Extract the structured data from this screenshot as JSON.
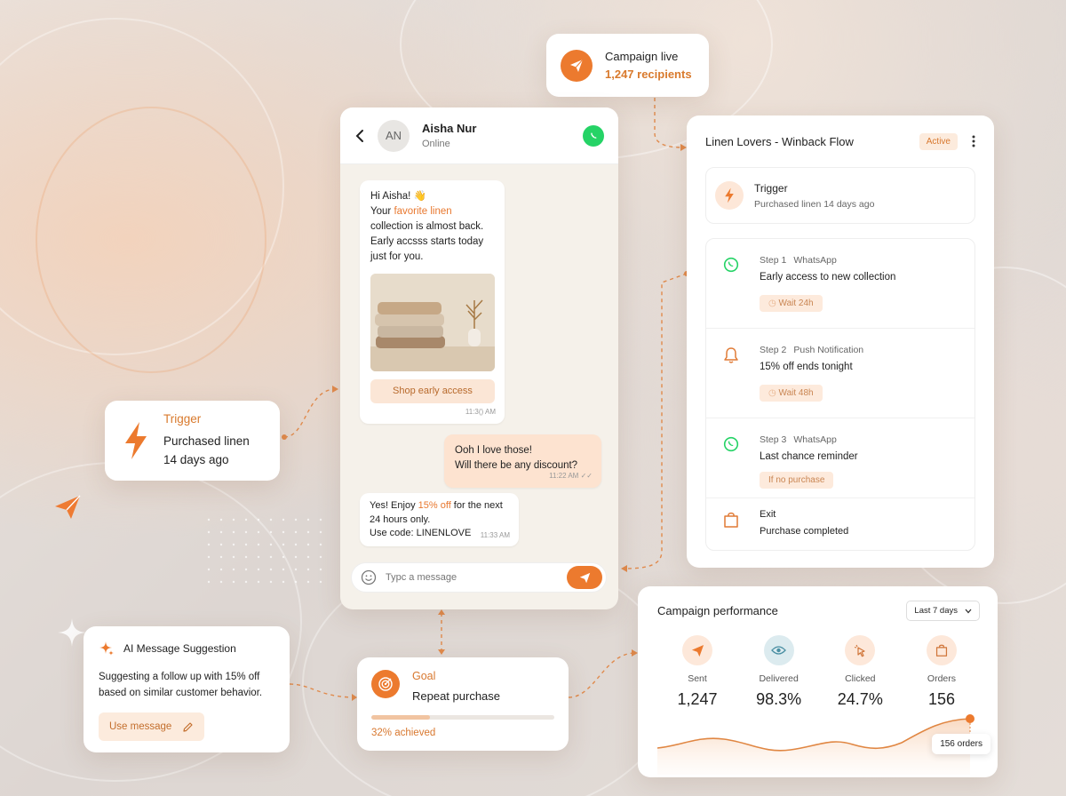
{
  "campaign_live": {
    "title": "Campaign live",
    "recipients": "1,247 recipients"
  },
  "chat": {
    "contact_initials": "AN",
    "contact_name": "Aisha Nur",
    "contact_status": "Online",
    "msg1": {
      "greeting": "Hi Aisha! 👋",
      "line_pre": "Your ",
      "line_highlight": "favorite linen",
      "line_rest": "collection is almost back. Early accsss starts today just for you.",
      "button": "Shop early access",
      "time": "11:3() AM"
    },
    "msg2": {
      "line1": "Ooh I love those!",
      "line2": "Will there be any discount?",
      "time": "11:22 AM"
    },
    "msg3": {
      "pre": "Yes! Enjoy ",
      "highlight": "15% off",
      "rest": " for the next 24 hours only.",
      "line3": "Use code: LINENLOVE",
      "time": "11:33 AM"
    },
    "input_placeholder": "Typc a message"
  },
  "trigger_card": {
    "label": "Trigger",
    "line1": "Purchased linen",
    "line2": "14 days ago"
  },
  "flow": {
    "title": "Linen Lovers - Winback Flow",
    "status": "Active",
    "trigger_label": "Trigger",
    "trigger_desc": "Purchased linen 14 days ago",
    "steps": [
      {
        "num": "Step 1",
        "channel": "WhatsApp",
        "title": "Early access to new collection",
        "chip": "Wait 24h",
        "icon": "whatsapp-icon"
      },
      {
        "num": "Step 2",
        "channel": "Push Notification",
        "title": "15% off ends tonight",
        "chip": "Wait 48h",
        "icon": "bell-icon"
      },
      {
        "num": "Step 3",
        "channel": "WhatsApp",
        "title": "Last chance reminder",
        "chip": "If no purchase",
        "icon": "whatsapp-icon"
      },
      {
        "num": "Exit",
        "channel": "",
        "title": "Purchase completed",
        "chip": "",
        "icon": "shopping-bag-icon"
      }
    ]
  },
  "ai": {
    "title": "AI Message Suggestion",
    "text": "Suggesting a follow up with 15% off based on similar customer behavior.",
    "button": "Use message"
  },
  "goal": {
    "label": "Goal",
    "title": "Repeat purchase",
    "progress_label": "32% achieved",
    "progress": 0.32
  },
  "performance": {
    "title": "Campaign performance",
    "range": "Last 7 days",
    "metrics": [
      {
        "label": "Sent",
        "value": "1,247",
        "icon": "send-icon"
      },
      {
        "label": "Delivered",
        "value": "98.3%",
        "icon": "eye-icon"
      },
      {
        "label": "Clicked",
        "value": "24.7%",
        "icon": "cursor-click-icon"
      },
      {
        "label": "Orders",
        "value": "156",
        "icon": "shopping-bag-icon"
      }
    ],
    "tooltip": "156 orders"
  },
  "colors": {
    "accent": "#ec7a2e",
    "whatsapp": "#25d366"
  }
}
